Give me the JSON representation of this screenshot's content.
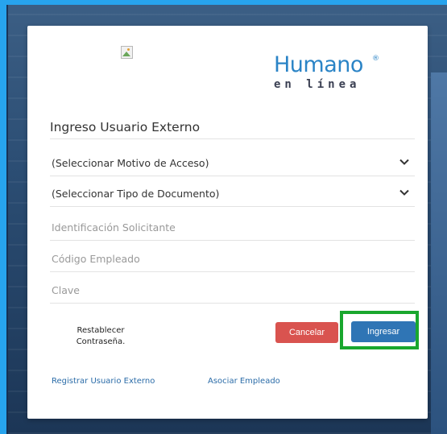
{
  "logo": {
    "main": "Humano",
    "registered": "®",
    "sub": "en línea"
  },
  "form": {
    "title": "Ingreso Usuario Externo",
    "motivo_select": "(Seleccionar Motivo de Acceso)",
    "tipo_doc_select": "(Seleccionar Tipo de Documento)",
    "identificacion_placeholder": "Identificación Solicitante",
    "codigo_placeholder": "Código Empleado",
    "clave_placeholder": "Clave"
  },
  "actions": {
    "restablecer_line1": "Restablecer",
    "restablecer_line2": "Contraseña.",
    "cancel_label": "Cancelar",
    "submit_label": "Ingresar"
  },
  "links": {
    "registrar": "Registrar Usuario Externo",
    "asociar": "Asociar Empleado"
  },
  "colors": {
    "brand_blue": "#2b84c6",
    "cancel_red": "#d9534f",
    "submit_blue": "#2f75b5",
    "highlight_green": "#19a72e"
  },
  "icons": {
    "broken_image": "broken-image-icon",
    "chevron": "chevron-down-icon"
  }
}
